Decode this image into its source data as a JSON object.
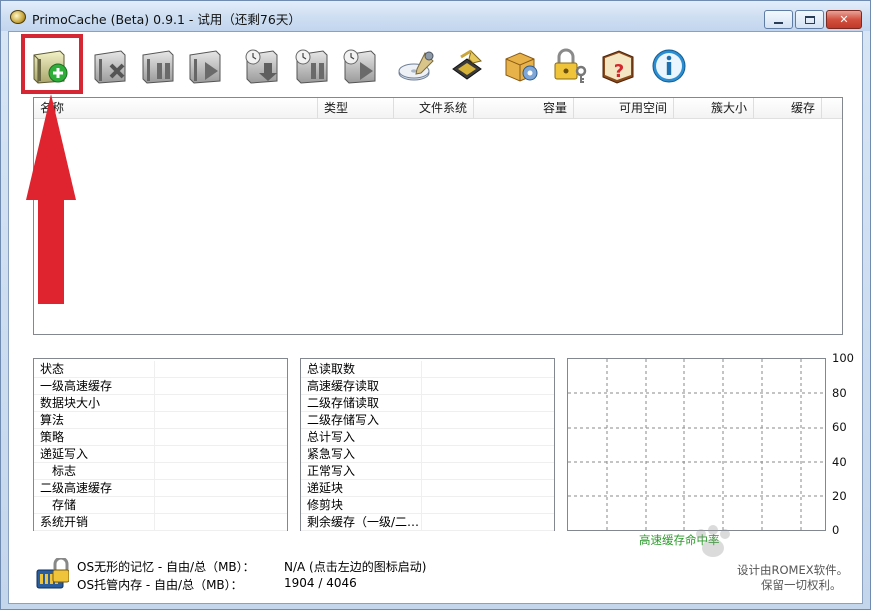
{
  "window": {
    "title": "PrimoCache (Beta) 0.9.1 - 试用（还剩76天）",
    "min_label": "▭",
    "max_label": "□",
    "close_label": "✕"
  },
  "toolbar": {
    "buttons": [
      {
        "name": "create-cache-task",
        "icon": "drive-add-icon"
      },
      {
        "name": "delete-cache-task",
        "icon": "drive-delete-icon"
      },
      {
        "name": "pause-cache-task",
        "icon": "drive-pause-icon"
      },
      {
        "name": "resume-cache-task",
        "icon": "drive-play-icon"
      },
      {
        "name": "flush-deferred-write",
        "icon": "drive-flush-icon"
      },
      {
        "name": "pause-deferred-write",
        "icon": "drive-timer-pause-icon"
      },
      {
        "name": "resume-deferred-write",
        "icon": "drive-timer-play-icon"
      },
      {
        "name": "cache-configuration",
        "icon": "disk-wrench-icon"
      },
      {
        "name": "chip-settings",
        "icon": "chip-wrench-icon"
      },
      {
        "name": "preferences",
        "icon": "box-gear-icon"
      },
      {
        "name": "license",
        "icon": "padlock-key-icon"
      },
      {
        "name": "help",
        "icon": "book-question-icon"
      },
      {
        "name": "about",
        "icon": "info-icon"
      }
    ]
  },
  "device_list": {
    "columns": [
      "名称",
      "类型",
      "文件系统",
      "容量",
      "可用空间",
      "簇大小",
      "缓存"
    ],
    "rows": []
  },
  "status_panel": {
    "rows": [
      {
        "label": "状态",
        "indent": false
      },
      {
        "label": "一级高速缓存",
        "indent": false
      },
      {
        "label": "数据块大小",
        "indent": false
      },
      {
        "label": "算法",
        "indent": false
      },
      {
        "label": "策略",
        "indent": false
      },
      {
        "label": "递延写入",
        "indent": false
      },
      {
        "label": "标志",
        "indent": true
      },
      {
        "label": "二级高速缓存",
        "indent": false
      },
      {
        "label": "存储",
        "indent": true
      },
      {
        "label": "系统开销",
        "indent": false
      }
    ]
  },
  "stats_panel": {
    "rows": [
      {
        "label": "总读取数"
      },
      {
        "label": "高速缓存读取"
      },
      {
        "label": "二级存储读取"
      },
      {
        "label": "二级存储写入"
      },
      {
        "label": "总计写入"
      },
      {
        "label": "紧急写入"
      },
      {
        "label": "正常写入"
      },
      {
        "label": "递延块"
      },
      {
        "label": "修剪块"
      },
      {
        "label": "剩余缓存（一级/二…"
      }
    ]
  },
  "graph": {
    "y_ticks": [
      "100",
      "80",
      "60",
      "40",
      "20",
      "0"
    ],
    "legend": "高速缓存命中率",
    "legend_color": "#2a9a2a"
  },
  "footer": {
    "invisible_memory_label": "OS无形的记忆 - 自由/总（MB）：",
    "invisible_memory_value": "N/A (点击左边的图标启动)",
    "managed_memory_label": "OS托管内存 - 自由/总（MB）：",
    "managed_memory_value": "1904 / 4046",
    "copyright_1": "设计由ROMEX软件。",
    "copyright_2": "保留一切权利。"
  },
  "annotation": {
    "highlight_color": "#d52733",
    "arrow_color": "#e0242f"
  }
}
